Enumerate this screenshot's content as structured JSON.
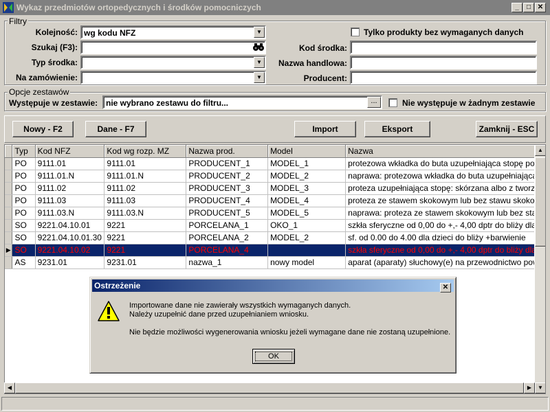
{
  "window": {
    "title": "Wykaz przedmiotów ortopedycznych i środków pomocniczych",
    "controls": [
      "_",
      "□",
      "✕"
    ]
  },
  "filters": {
    "group_title": "Filtry",
    "kolejnosc_label": "Kolejność:",
    "kolejnosc_value": "wg kodu NFZ",
    "szukaj_label": "Szukaj (F3):",
    "szukaj_value": "",
    "typ_label": "Typ środka:",
    "typ_value": "",
    "zamowienie_label": "Na zamówienie:",
    "zamowienie_value": "",
    "only_missing_label": "Tylko produkty bez wymaganych danych",
    "kod_label": "Kod środka:",
    "kod_value": "",
    "nazwa_label": "Nazwa handlowa:",
    "nazwa_value": "",
    "producent_label": "Producent:",
    "producent_value": ""
  },
  "sets": {
    "group_title": "Opcje zestawów",
    "in_set_label": "Występuje w zestawie:",
    "in_set_value": "nie wybrano zestawu do filtru...",
    "browse_label": "...",
    "not_in_any_label": "Nie występuje w żadnym zestawie"
  },
  "toolbar": {
    "new_label": "Nowy - F2",
    "data_label": "Dane - F7",
    "import_label": "Import",
    "export_label": "Eksport",
    "close_label": "Zamknij - ESC"
  },
  "table": {
    "columns": [
      "Typ",
      "Kod NFZ",
      "Kod wg rozp. MZ",
      "Nazwa prod.",
      "Model",
      "Nazwa"
    ],
    "rows": [
      [
        "PO",
        "9111.01",
        "9111.01",
        "PRODUCENT_1",
        "MODEL_1",
        "protezowa wkładka do buta uzupełniająca stopę po"
      ],
      [
        "PO",
        "9111.01.N",
        "9111.01.N",
        "PRODUCENT_2",
        "MODEL_2",
        "naprawa: protezowa wkładka do buta uzupełniająca"
      ],
      [
        "PO",
        "9111.02",
        "9111.02",
        "PRODUCENT_3",
        "MODEL_3",
        "proteza uzupełniająca stopę: skórzana albo z tworzy"
      ],
      [
        "PO",
        "9111.03",
        "9111.03",
        "PRODUCENT_4",
        "MODEL_4",
        "proteza ze stawem skokowym lub bez stawu skokow"
      ],
      [
        "PO",
        "9111.03.N",
        "9111.03.N",
        "PRODUCENT_5",
        "MODEL_5",
        "naprawa: proteza ze stawem skokowym lub bez staw"
      ],
      [
        "SO",
        "9221.04.10.01",
        "9221",
        "PORCELANA_1",
        "OKO_1",
        "szkła sferyczne od 0,00 do +,- 4,00 dptr do bliży dla"
      ],
      [
        "SO",
        "9221.04.10.01.30",
        "9221",
        "PORCELANA_2",
        "MODEL_2",
        "sf. od 0.00 do 4.00 dla dzieci do bliży +barwienie"
      ],
      [
        "SO",
        "9221.04.10.02",
        "9221",
        "PORCELANA_4",
        "",
        "szkła sferyczne od 0,00 do +,- 4,00 dptr do bliży dla"
      ],
      [
        "AS",
        "9231.01",
        "9231.01",
        "nazwa_1",
        "nowy model",
        "aparat (aparaty) słuchowy(e) na przewodnictwo pow"
      ]
    ],
    "selected_row": 7,
    "row_indicator": "▶"
  },
  "dialog": {
    "title": "Ostrzeżenie",
    "close": "✕",
    "line1": "Importowane dane nie zawierały wszystkich wymaganych danych.",
    "line2": "Należy uzupełnić dane przed uzupełnianiem wniosku.",
    "line3": "Nie będzie możliwości wygenerowania wniosku jeżeli wymagane dane nie zostaną uzupełnione.",
    "ok_label": "OK",
    "icon": "warning-icon"
  }
}
